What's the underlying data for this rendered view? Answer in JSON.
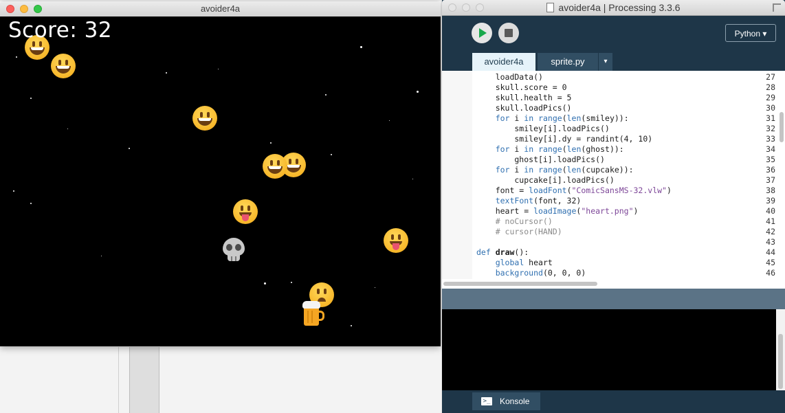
{
  "game_window": {
    "title": "avoider4a",
    "score_text": "Score: 32",
    "sprites": [
      {
        "kind": "smiley"
      },
      {
        "kind": "smiley"
      },
      {
        "kind": "smiley"
      },
      {
        "kind": "smiley"
      },
      {
        "kind": "smiley"
      },
      {
        "kind": "tongue"
      },
      {
        "kind": "tongue"
      },
      {
        "kind": "skull"
      },
      {
        "kind": "sad"
      },
      {
        "kind": "beer"
      }
    ]
  },
  "ide_window": {
    "title": "avoider4a | Processing 3.3.6",
    "toolbar": {
      "run_icon": "play-icon",
      "stop_icon": "stop-icon",
      "mode_label": "Python ▾"
    },
    "tabs": [
      {
        "label": "avoider4a",
        "active": true
      },
      {
        "label": "sprite.py",
        "active": false
      }
    ],
    "tab_menu_glyph": "▾",
    "code_lines": [
      {
        "n": "27",
        "text": "    loadData()"
      },
      {
        "n": "28",
        "text": "    skull.score = 0"
      },
      {
        "n": "29",
        "text": "    skull.health = 5"
      },
      {
        "n": "30",
        "text": "    skull.loadPics()"
      },
      {
        "n": "31",
        "text": "    for i in range(len(smiley)):"
      },
      {
        "n": "32",
        "text": "        smiley[i].loadPics()"
      },
      {
        "n": "33",
        "text": "        smiley[i].dy = randint(4, 10)"
      },
      {
        "n": "34",
        "text": "    for i in range(len(ghost)):"
      },
      {
        "n": "35",
        "text": "        ghost[i].loadPics()"
      },
      {
        "n": "36",
        "text": "    for i in range(len(cupcake)):"
      },
      {
        "n": "37",
        "text": "        cupcake[i].loadPics()"
      },
      {
        "n": "38",
        "text": "    font = loadFont(\"ComicSansMS-32.vlw\")"
      },
      {
        "n": "39",
        "text": "    textFont(font, 32)"
      },
      {
        "n": "40",
        "text": "    heart = loadImage(\"heart.png\")"
      },
      {
        "n": "41",
        "text": "    # noCursor()"
      },
      {
        "n": "42",
        "text": "    # cursor(HAND)"
      },
      {
        "n": "43",
        "text": ""
      },
      {
        "n": "44",
        "text": "def draw():"
      },
      {
        "n": "45",
        "text": "    global heart"
      },
      {
        "n": "46",
        "text": "    background(0, 0, 0)"
      }
    ],
    "console_tab_label": "Konsole"
  }
}
